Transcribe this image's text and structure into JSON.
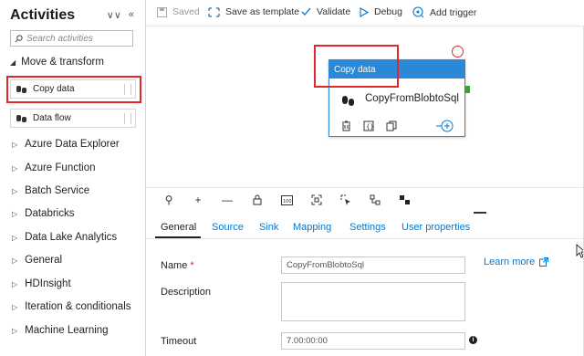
{
  "sidebar": {
    "title": "Activities",
    "search_placeholder": "Search activities",
    "group": "Move & transform",
    "items": [
      {
        "label": "Copy data"
      },
      {
        "label": "Data flow"
      }
    ],
    "categories": [
      "Azure Data Explorer",
      "Azure Function",
      "Batch Service",
      "Databricks",
      "Data Lake Analytics",
      "General",
      "HDInsight",
      "Iteration & conditionals",
      "Machine Learning"
    ]
  },
  "toolbar": {
    "saved": "Saved",
    "save_template": "Save as template",
    "validate": "Validate",
    "debug": "Debug",
    "add_trigger": "Add trigger"
  },
  "node": {
    "header": "Copy data",
    "name": "CopyFromBlobtoSql"
  },
  "tabs": [
    "General",
    "Source",
    "Sink",
    "Mapping",
    "Settings",
    "User properties"
  ],
  "props": {
    "name_label": "Name",
    "name_required": "*",
    "name_value": "CopyFromBlobtoSql",
    "learn_more": "Learn more",
    "description_label": "Description",
    "timeout_label": "Timeout",
    "timeout_value": "7.00:00:00"
  },
  "colors": {
    "accent": "#2b88d8",
    "highlight": "#e2262b",
    "link": "#0078d4"
  }
}
